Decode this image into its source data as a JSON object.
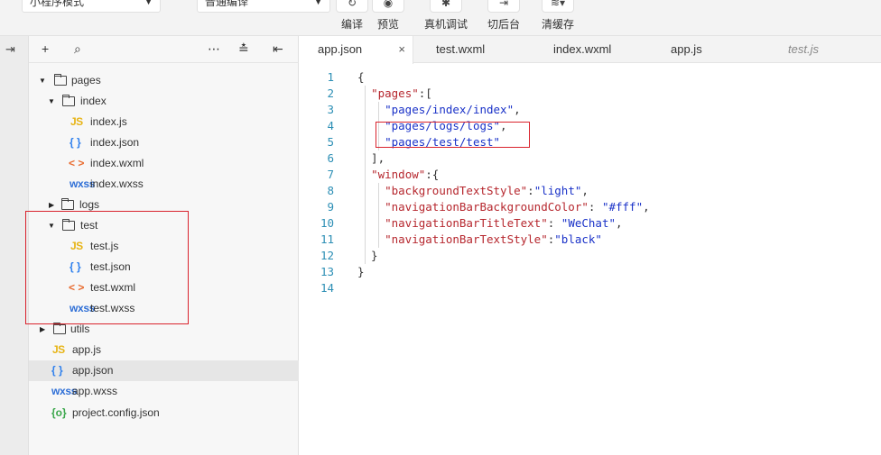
{
  "toolbar": {
    "mode_select": "小程序模式",
    "compile_select": "普通编译",
    "buttons": [
      {
        "id": "compile",
        "label": "编译",
        "icon": "refresh-icon"
      },
      {
        "id": "preview",
        "label": "预览",
        "icon": "eye-icon"
      },
      {
        "id": "remote_debug",
        "label": "真机调试",
        "icon": "bug-icon"
      },
      {
        "id": "background",
        "label": "切后台",
        "icon": "switch-icon"
      },
      {
        "id": "clear_cache",
        "label": "清缓存",
        "icon": "layers-icon"
      }
    ]
  },
  "explorer": {
    "header_icons": [
      "add-icon",
      "search-icon",
      "more-icon",
      "collapse-all-icon",
      "sidebar-toggle-icon"
    ],
    "tree": [
      {
        "label": "pages",
        "type": "folder",
        "expanded": true
      },
      {
        "label": "index",
        "type": "folder",
        "expanded": true
      },
      {
        "label": "index.js",
        "type": "js"
      },
      {
        "label": "index.json",
        "type": "json"
      },
      {
        "label": "index.wxml",
        "type": "wxml"
      },
      {
        "label": "index.wxss",
        "type": "wxss"
      },
      {
        "label": "logs",
        "type": "folder",
        "expanded": false
      },
      {
        "label": "test",
        "type": "folder",
        "expanded": true
      },
      {
        "label": "test.js",
        "type": "js"
      },
      {
        "label": "test.json",
        "type": "json"
      },
      {
        "label": "test.wxml",
        "type": "wxml"
      },
      {
        "label": "test.wxss",
        "type": "wxss"
      },
      {
        "label": "utils",
        "type": "folder",
        "expanded": false
      },
      {
        "label": "app.js",
        "type": "js"
      },
      {
        "label": "app.json",
        "type": "json",
        "selected": true
      },
      {
        "label": "app.wxss",
        "type": "wxss"
      },
      {
        "label": "project.config.json",
        "type": "config"
      }
    ],
    "icon_glyphs": {
      "js": "JS",
      "json": "{ }",
      "wxml": "< >",
      "wxss": "wxss",
      "config": "{o}"
    }
  },
  "editor": {
    "tabs": [
      {
        "label": "app.json",
        "active": true,
        "closable": true
      },
      {
        "label": "test.wxml"
      },
      {
        "label": "index.wxml"
      },
      {
        "label": "app.js"
      },
      {
        "label": "test.js",
        "preview": true
      }
    ],
    "close_glyph": "×",
    "lines": [
      "{",
      "  \"pages\":[",
      "    \"pages/index/index\",",
      "    \"pages/logs/logs\",",
      "    \"pages/test/test\"",
      "  ],",
      "  \"window\":{",
      "    \"backgroundTextStyle\":\"light\",",
      "    \"navigationBarBackgroundColor\": \"#fff\",",
      "    \"navigationBarTitleText\": \"WeChat\",",
      "    \"navigationBarTextStyle\":\"black\"",
      "  }",
      "}",
      ""
    ]
  },
  "colors": {
    "highlight_box": "#d9232d",
    "json_key": "#b6272e",
    "json_string": "#1a32c8",
    "line_number": "#2d8fb5"
  }
}
